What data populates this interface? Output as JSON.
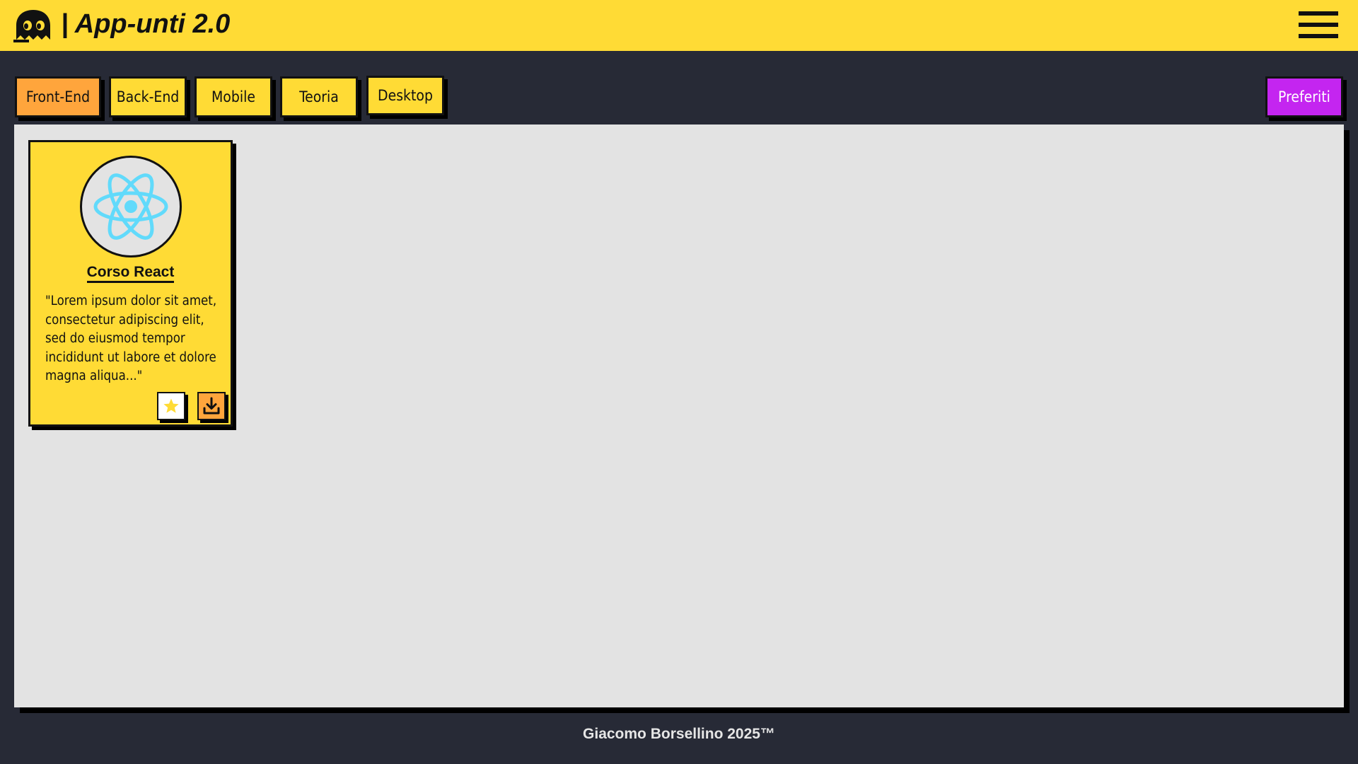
{
  "header": {
    "title": "| App-unti 2.0",
    "logo_icon": "ghost-icon",
    "menu_icon": "hamburger-menu-icon"
  },
  "categories": [
    {
      "label": "Front-End",
      "active": true
    },
    {
      "label": "Back-End",
      "active": false
    },
    {
      "label": "Mobile",
      "active": false
    },
    {
      "label": "Teoria",
      "active": false
    },
    {
      "label": "Desktop",
      "active": false
    }
  ],
  "favorites_button": "Preferiti",
  "cards": [
    {
      "title": "Corso React",
      "description": "\"Lorem ipsum dolor sit amet, consectetur adipiscing elit, sed do eiusmod tempor incididunt ut labore et dolore magna aliqua...\"",
      "image_icon": "react-logo-icon",
      "favorite_icon": "star-icon",
      "download_icon": "download-icon"
    }
  ],
  "footer": {
    "text": "Giacomo Borsellino 2025™"
  },
  "colors": {
    "brand_yellow": "#ffdb35",
    "active_orange": "#ffa53c",
    "favorites_purple": "#c425f0",
    "background_dark": "#272a36",
    "panel_gray": "#e3e3e3",
    "react_blue": "#61dafb"
  }
}
